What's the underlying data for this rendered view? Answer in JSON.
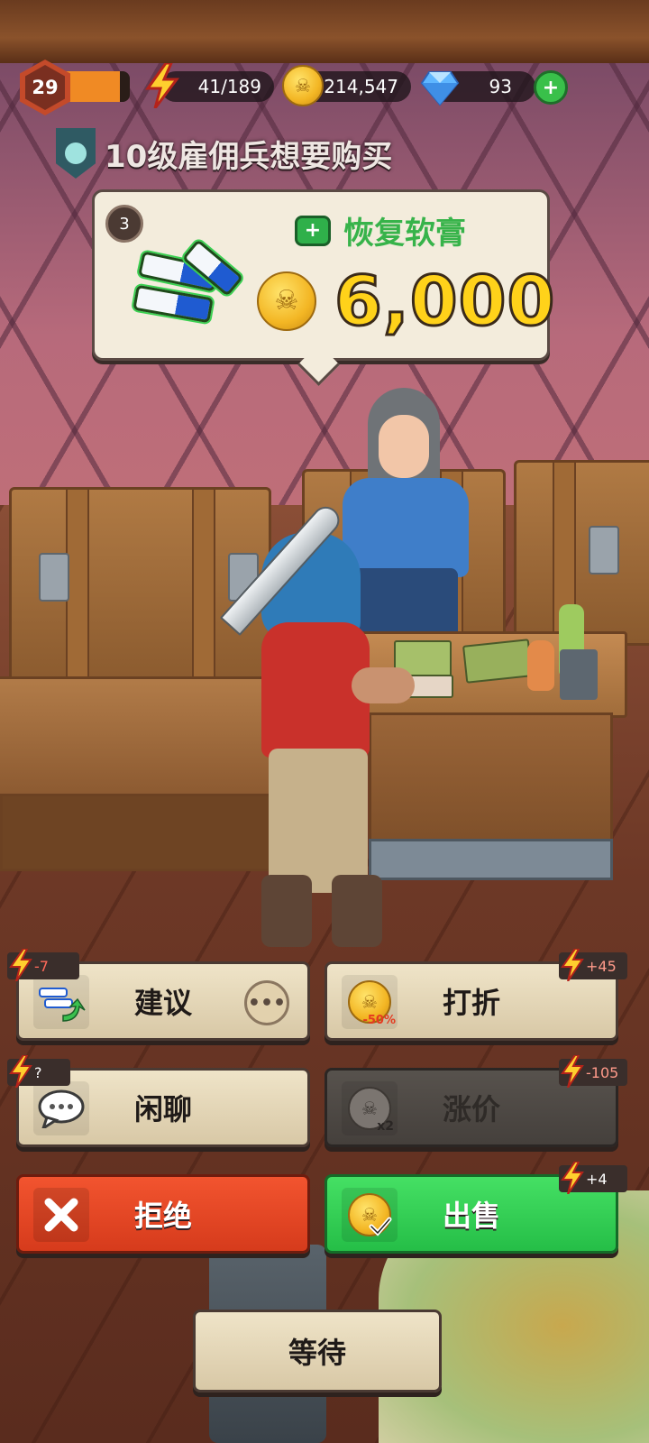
{
  "hud": {
    "level": "29",
    "xp_progress": 0.85,
    "energy": "41/189",
    "coins": "214,547",
    "gems": "93",
    "add_label": "+",
    "icons": [
      "energy-bolt-icon",
      "coin-icon",
      "gem-icon",
      "plus-icon"
    ]
  },
  "request": {
    "text": "10级雇佣兵想要购买",
    "quantity": "3",
    "item_name": "恢复软膏",
    "price": "6,000"
  },
  "actions": {
    "suggest": {
      "label": "建议",
      "cost": "-7",
      "more": "•••"
    },
    "discount": {
      "label": "打折",
      "cost": "+45",
      "badge": "-50%"
    },
    "chat": {
      "label": "闲聊",
      "cost": "?"
    },
    "raise": {
      "label": "涨价",
      "cost": "-105",
      "badge": "x2"
    },
    "refuse": {
      "label": "拒绝"
    },
    "sell": {
      "label": "出售",
      "cost": "+4"
    },
    "wait": {
      "label": "等待"
    }
  },
  "colors": {
    "energy": "#f08a24",
    "gold": "#ffd21a",
    "item_green": "#37b34a",
    "refuse_red": "#e5461f",
    "sell_green": "#33cf55",
    "button_cream": "#e6d9ba"
  }
}
